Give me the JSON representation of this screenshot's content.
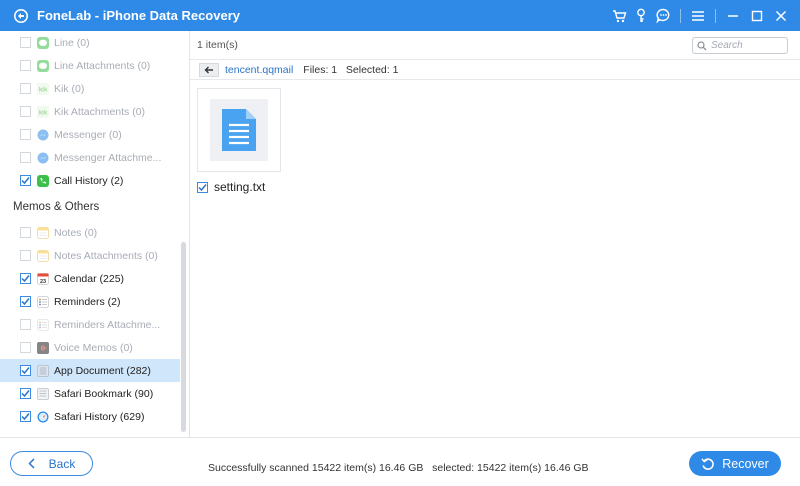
{
  "window": {
    "title": "FoneLab - iPhone Data Recovery",
    "brand_color": "#2e8ae6"
  },
  "titlebar_icons": [
    "cart-icon",
    "key-icon",
    "chat-icon",
    "menu-icon",
    "minimize-icon",
    "maximize-icon",
    "close-icon"
  ],
  "sidebar": {
    "items_top": [
      {
        "label": "Line (0)",
        "checked": false,
        "enabled": false,
        "icon": "line-icon"
      },
      {
        "label": "Line Attachments (0)",
        "checked": false,
        "enabled": false,
        "icon": "line-icon"
      },
      {
        "label": "Kik (0)",
        "checked": false,
        "enabled": false,
        "icon": "kik-icon"
      },
      {
        "label": "Kik Attachments (0)",
        "checked": false,
        "enabled": false,
        "icon": "kik-icon"
      },
      {
        "label": "Messenger (0)",
        "checked": false,
        "enabled": false,
        "icon": "messenger-icon"
      },
      {
        "label": "Messenger Attachme...",
        "checked": false,
        "enabled": false,
        "icon": "messenger-icon"
      },
      {
        "label": "Call History (2)",
        "checked": true,
        "enabled": true,
        "icon": "phone-icon"
      }
    ],
    "section_title": "Memos & Others",
    "items_bottom": [
      {
        "label": "Notes (0)",
        "checked": false,
        "enabled": false,
        "icon": "notes-icon"
      },
      {
        "label": "Notes Attachments (0)",
        "checked": false,
        "enabled": false,
        "icon": "notes-icon"
      },
      {
        "label": "Calendar (225)",
        "checked": true,
        "enabled": true,
        "icon": "calendar-icon"
      },
      {
        "label": "Reminders (2)",
        "checked": true,
        "enabled": true,
        "icon": "reminders-icon"
      },
      {
        "label": "Reminders Attachme...",
        "checked": false,
        "enabled": false,
        "icon": "reminders-icon"
      },
      {
        "label": "Voice Memos (0)",
        "checked": false,
        "enabled": false,
        "icon": "voice-memos-icon"
      },
      {
        "label": "App Document (282)",
        "checked": true,
        "enabled": true,
        "selected": true,
        "icon": "app-document-icon"
      },
      {
        "label": "Safari Bookmark (90)",
        "checked": true,
        "enabled": true,
        "icon": "bookmark-icon"
      },
      {
        "label": "Safari History (629)",
        "checked": true,
        "enabled": true,
        "icon": "safari-icon"
      }
    ]
  },
  "main": {
    "item_count": "1 item(s)",
    "search_placeholder": "Search",
    "path_name": "tencent.qqmail",
    "path_stats": "Files: 1   Selected: 1",
    "file": {
      "name": "setting.txt",
      "checked": true
    }
  },
  "bottom": {
    "back_label": "Back",
    "status": "Successfully scanned 15422 item(s) 16.46 GB   selected: 15422 item(s) 16.46 GB",
    "recover_label": "Recover"
  }
}
